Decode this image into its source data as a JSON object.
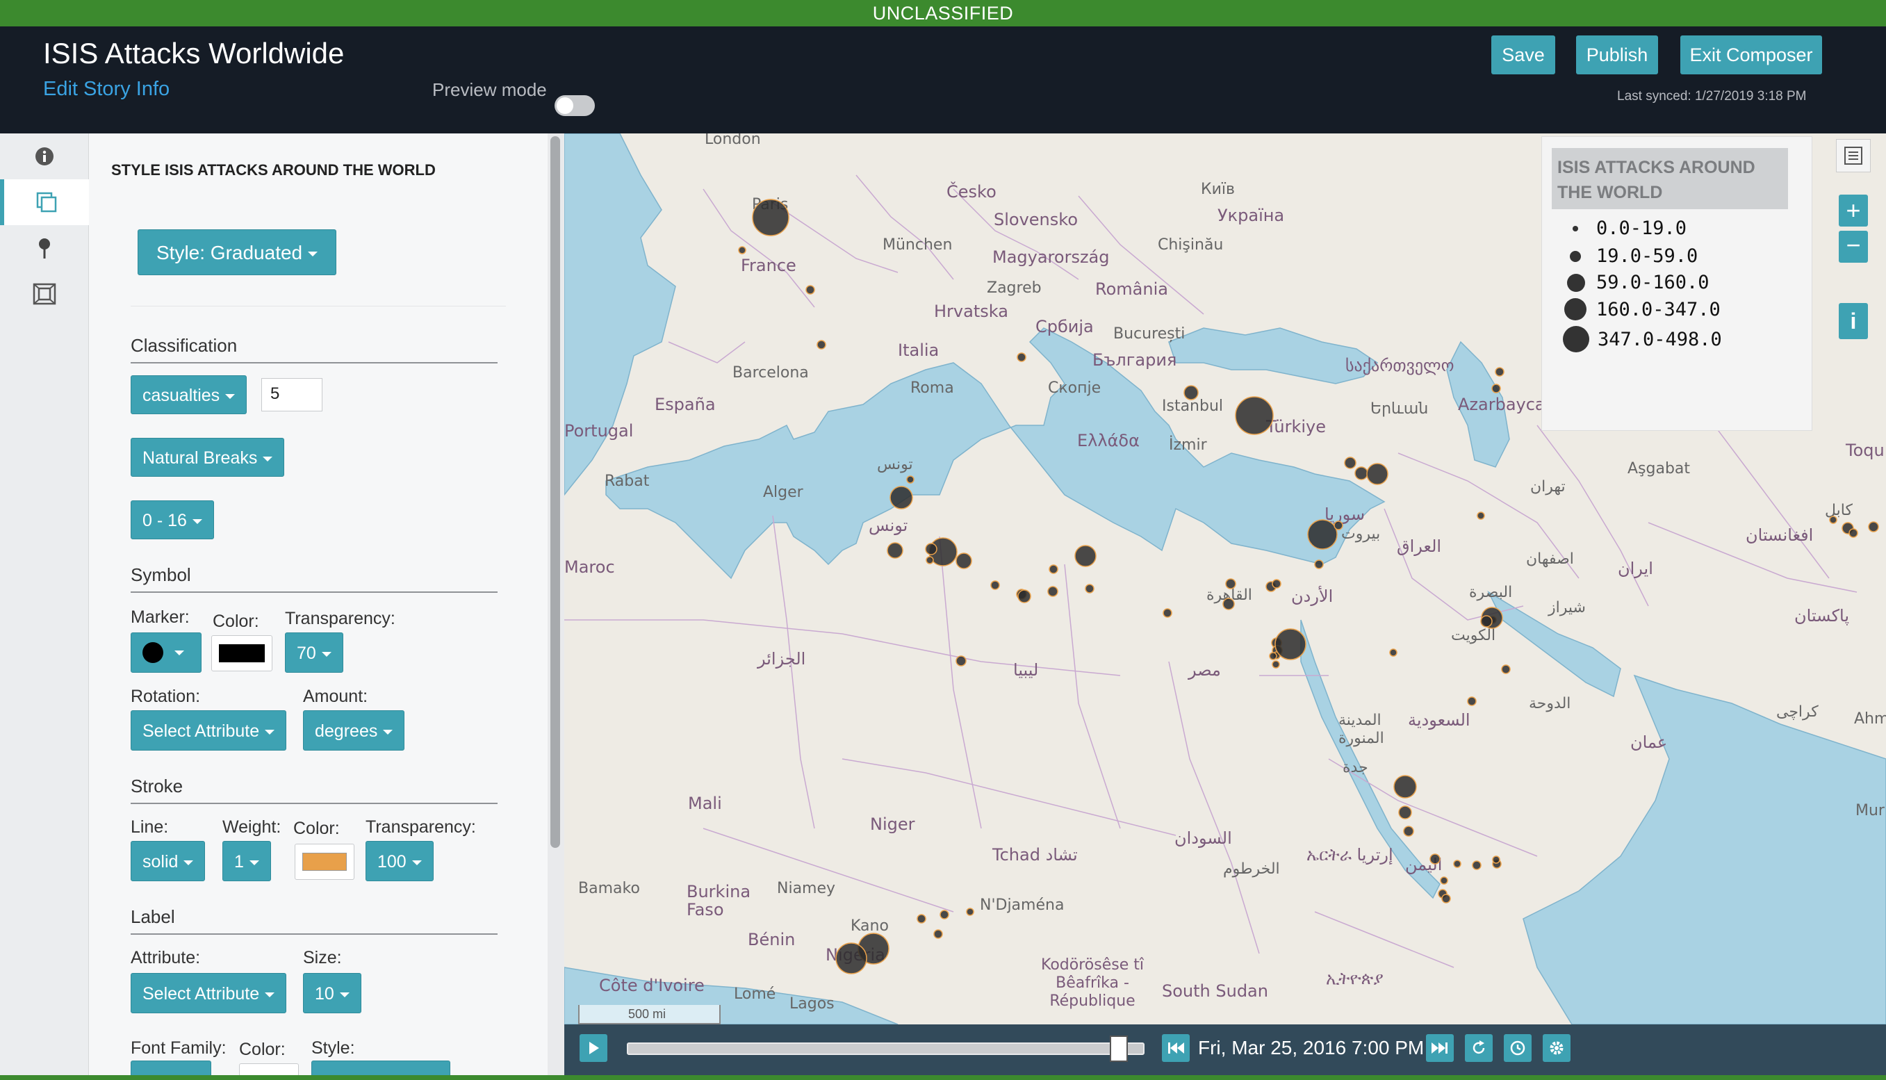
{
  "classification_banner": "UNCLASSIFIED",
  "header": {
    "title": "ISIS Attacks Worldwide",
    "edit_link": "Edit Story Info",
    "preview_label": "Preview mode",
    "save": "Save",
    "publish": "Publish",
    "exit": "Exit Composer",
    "last_synced": "Last synced: 1/27/2019 3:18 PM"
  },
  "sidebar_icons": [
    "info-icon",
    "layers-icon",
    "pin-icon",
    "frame-icon"
  ],
  "panel": {
    "title": "STYLE ISIS ATTACKS AROUND THE WORLD",
    "style_button": "Style: Graduated",
    "classification": {
      "heading": "Classification",
      "attribute": "casualties",
      "classes": "5",
      "method": "Natural Breaks",
      "range": "0 - 16"
    },
    "symbol": {
      "heading": "Symbol",
      "marker_label": "Marker:",
      "color_label": "Color:",
      "transparency_label": "Transparency:",
      "transparency": "70",
      "rotation_label": "Rotation:",
      "amount_label": "Amount:",
      "rotation": "Select Attribute",
      "amount": "degrees",
      "marker_color": "#000000"
    },
    "stroke": {
      "heading": "Stroke",
      "line_label": "Line:",
      "weight_label": "Weight:",
      "color_label": "Color:",
      "transparency_label": "Transparency:",
      "line": "solid",
      "weight": "1",
      "transparency": "100",
      "stroke_color": "#e8a04a"
    },
    "label": {
      "heading": "Label",
      "attribute_label": "Attribute:",
      "size_label": "Size:",
      "attribute": "Select Attribute",
      "size": "10",
      "font_family_label": "Font Family:",
      "color_label": "Color:",
      "style_label": "Style:"
    }
  },
  "legend": {
    "title": "ISIS ATTACKS AROUND THE WORLD",
    "items": [
      {
        "label": "0.0-19.0"
      },
      {
        "label": "19.0-59.0"
      },
      {
        "label": "59.0-160.0"
      },
      {
        "label": "160.0-347.0"
      },
      {
        "label": "347.0-498.0"
      }
    ]
  },
  "map": {
    "scale": "500 mi",
    "labels": {
      "london": "London",
      "cesko": "Česko",
      "kyiv": "Київ",
      "ukraina": "Україна",
      "slovensko": "Slovensko",
      "paris": "Paris",
      "munchen": "München",
      "chisinau": "Chişinău",
      "magyar": "Magyarország",
      "france": "France",
      "zagreb": "Zagreb",
      "romania": "România",
      "hrvatska": "Hrvatska",
      "srbija": "Србија",
      "bucuresti": "București",
      "italia": "Italia",
      "balgaria": "България",
      "barcelona": "Barcelona",
      "roma": "Roma",
      "skopje": "Скопје",
      "istanbul": "Istanbul",
      "turkiye": "Türkiye",
      "espana": "España",
      "portugal": "Portugal",
      "ellada": "Ελλάδα",
      "izmir": "İzmir",
      "georgia": "საქართველო",
      "armenia": "Երևան",
      "azer": "Azarbaycan",
      "tunis": "تونس",
      "alger": "Alger",
      "rabat": "Rabat",
      "maroc": "Maroc",
      "tunisie": "تونس",
      "libya": "ليبيا",
      "aljazair": "الجزائر",
      "misr": "مصر",
      "cairo": "القاهرة",
      "urdun": "الأردن",
      "suriya": "سوريا",
      "beirut": "بيروت",
      "iraq": "العراق",
      "tehran": "تهران",
      "iran": "ایران",
      "asgabat": "Aşgabat",
      "isfahan": "اصفهان",
      "basra": "البصرة",
      "kuwait": "الكويت",
      "shiraz": "شیراز",
      "saudi": "السعودية",
      "madina": "المدينة المنورة",
      "jeddah": "جدة",
      "doha": "الدوحة",
      "oman": "عمان",
      "pakistan": "پاکستان",
      "karachi": "کراچی",
      "afghan": "افغانستان",
      "kabul": "کابل",
      "mali": "Mali",
      "niger": "Niger",
      "tchad": "Tchad تشاد",
      "sudan": "السودان",
      "khartoum": "الخرطوم",
      "eritrea": "ኤርትራ إرتريا",
      "yemen": "اليمن",
      "bamako": "Bamako",
      "burkina": "Burkina Faso",
      "niamey": "Niamey",
      "ndjamena": "N'Djaména",
      "kano": "Kano",
      "nigeria": "Nigeria",
      "benin": "Bénin",
      "civ": "Côte d'Ivoire",
      "lome": "Lomé",
      "lagos": "Lagos",
      "centrafrique": "Kodörösêse tî Bêafrîka - République Centrafricaine",
      "southsudan": "South Sudan",
      "ethiopia": "ኢትዮጵያ",
      "ahmed": "Ahmed",
      "mur": "Mur",
      "toq": "Toqu"
    }
  },
  "timeline": {
    "date": "Fri, Mar 25, 2016 7:00 PM",
    "progress": 0.95
  }
}
